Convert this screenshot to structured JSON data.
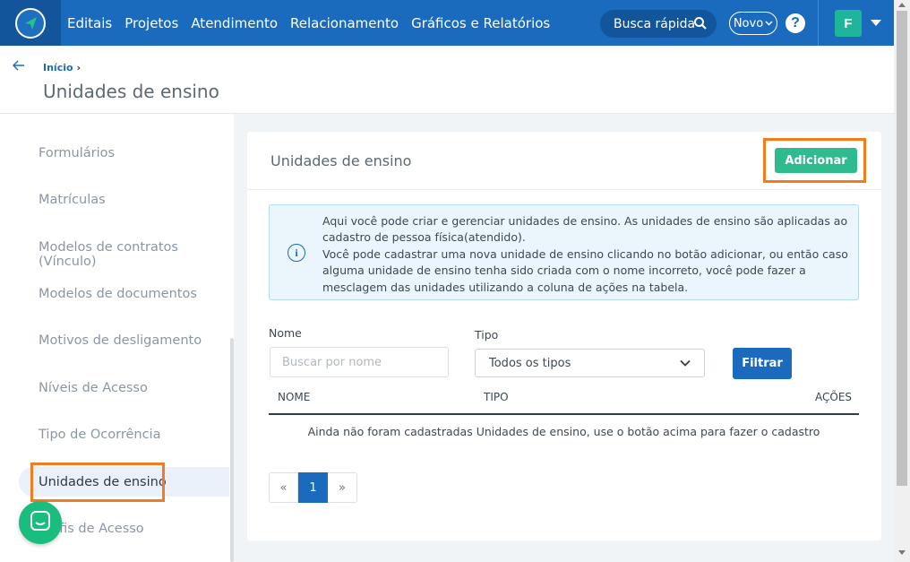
{
  "topbar": {
    "nav": [
      "Editais",
      "Projetos",
      "Atendimento",
      "Relacionamento",
      "Gráficos e Relatórios"
    ],
    "search_label": "Busca rápida",
    "novo_label": "Novo",
    "help_label": "?",
    "avatar_initial": "F"
  },
  "header": {
    "breadcrumb": "Início",
    "title": "Unidades de ensino"
  },
  "sidebar": {
    "items": [
      {
        "label": "Formulários"
      },
      {
        "label": "Matrículas"
      },
      {
        "label": "Modelos de contratos (Vínculo)"
      },
      {
        "label": "Modelos de documentos"
      },
      {
        "label": "Motivos de desligamento"
      },
      {
        "label": "Níveis de Acesso"
      },
      {
        "label": "Tipo de Ocorrência"
      },
      {
        "label": "Unidades de ensino",
        "active": true
      },
      {
        "label": "Perfis de Acesso"
      }
    ]
  },
  "card": {
    "title": "Unidades de ensino",
    "add_label": "Adicionar",
    "info_text": "Aqui você pode criar e gerenciar unidades de ensino. As unidades de ensino são aplicadas ao cadastro de pessoa física(atendido).\nVocê pode cadastrar uma nova unidade de ensino clicando no botão adicionar, ou então caso alguma unidade de ensino tenha sido criada com o nome incorreto, você pode fazer a mesclagem das unidades utilizando a coluna de ações na tabela.",
    "info_icon": "i",
    "filters": {
      "nome_label": "Nome",
      "nome_placeholder": "Buscar por nome",
      "tipo_label": "Tipo",
      "tipo_value": "Todos os tipos",
      "filter_label": "Filtrar"
    },
    "table": {
      "columns": [
        "NOME",
        "TIPO",
        "AÇÕES"
      ],
      "empty_message": "Ainda não foram cadastradas Unidades de ensino, use o botão acima para fazer o cadastro"
    },
    "pagination": {
      "prev": "«",
      "current": "1",
      "next": "»"
    }
  },
  "colors": {
    "primary": "#1a6bbd",
    "accent_green": "#2dbb8f",
    "highlight": "#f47c20"
  }
}
